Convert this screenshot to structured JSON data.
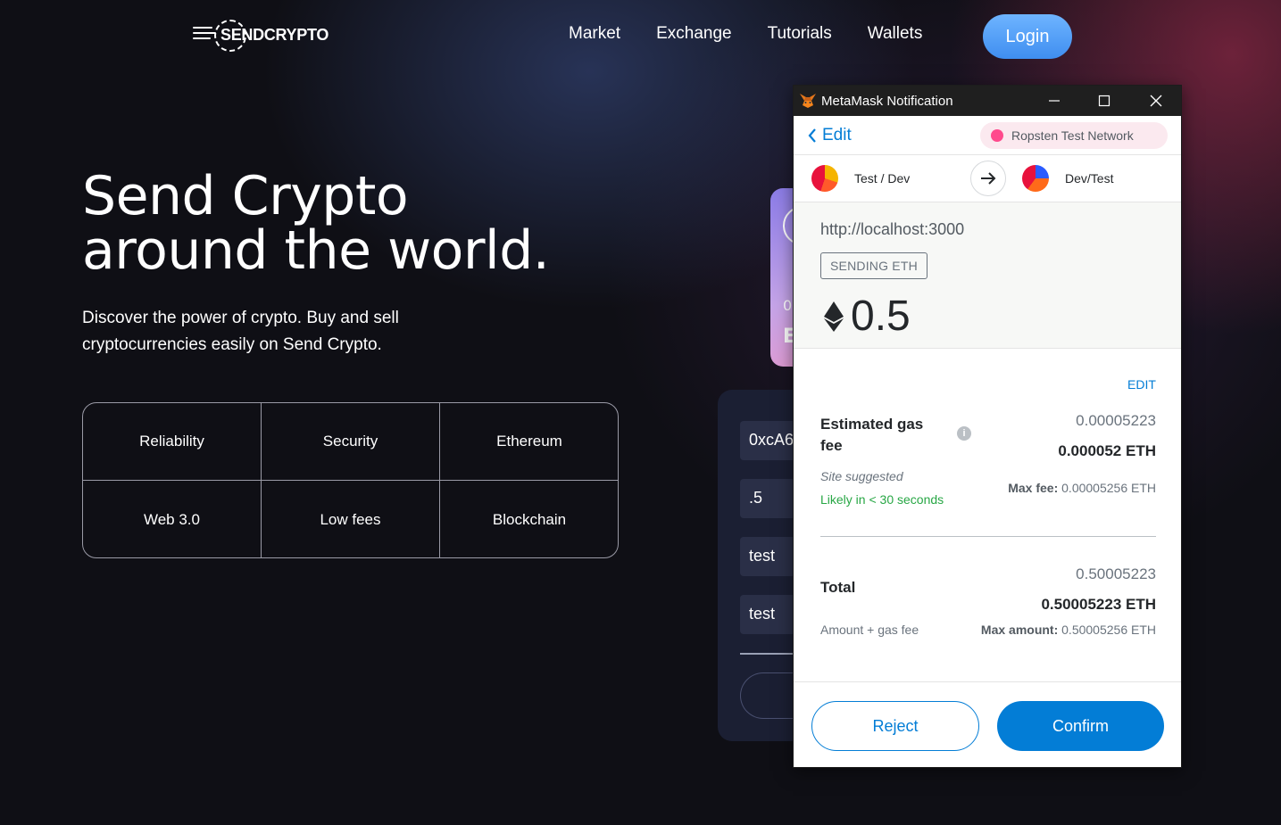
{
  "site": {
    "logo_text": "SENDCRYPTO",
    "nav": [
      "Market",
      "Exchange",
      "Tutorials",
      "Wallets"
    ],
    "login_label": "Login"
  },
  "hero": {
    "title_line1": "Send Crypto",
    "title_line2": "around the world.",
    "subtitle": "Discover the power of crypto. Buy and sell cryptocurrencies easily on Send Crypto.",
    "features": [
      "Reliability",
      "Security",
      "Ethereum",
      "Web 3.0",
      "Low fees",
      "Blockchain"
    ]
  },
  "card": {
    "line1": "0",
    "line2": "E"
  },
  "form": {
    "address_value": "0xcA6",
    "amount_value": ".5",
    "keyword_value": "test",
    "message_value": "test"
  },
  "metamask": {
    "window_title": "MetaMask Notification",
    "edit_label": "Edit",
    "network": "Ropsten Test Network",
    "from_account": "Test / Dev",
    "to_account": "Dev/Test",
    "origin": "http://localhost:3000",
    "action": "SENDING ETH",
    "amount": "0.5",
    "gas": {
      "edit_label": "EDIT",
      "label": "Estimated gas fee",
      "value_primary": "0.00005223",
      "value_eth": "0.000052 ETH",
      "site_suggested": "Site suggested",
      "likely": "Likely in < 30 seconds",
      "max_fee_label": "Max fee:",
      "max_fee_value": "0.00005256 ETH"
    },
    "total": {
      "label": "Total",
      "value_primary": "0.50005223",
      "value_eth": "0.50005223 ETH",
      "sub_label": "Amount + gas fee",
      "max_amount_label": "Max amount:",
      "max_amount_value": "0.50005256 ETH"
    },
    "reject_label": "Reject",
    "confirm_label": "Confirm",
    "colors": {
      "accent": "#037dd6",
      "network_dot": "#ff4a8d",
      "success": "#28a745"
    }
  }
}
